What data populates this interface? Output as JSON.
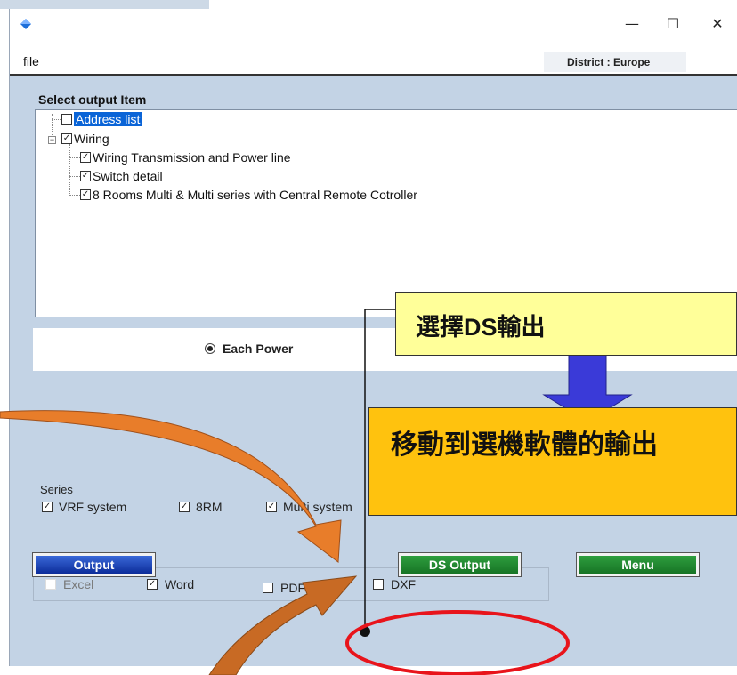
{
  "menu": {
    "file": "file"
  },
  "district": "District : Europe",
  "window_controls": {
    "minimize": "—",
    "maximize": "☐",
    "close": "✕"
  },
  "select_output": {
    "title": "Select output Item",
    "items": [
      {
        "label": "Address list",
        "checked": false,
        "selected": true
      },
      {
        "label": "Wiring",
        "checked": true
      },
      {
        "label": "Wiring Transmission and Power line",
        "checked": true
      },
      {
        "label": "Switch detail",
        "checked": true
      },
      {
        "label": "8 Rooms Multi & Multi series with Central Remote Cotroller",
        "checked": true
      }
    ]
  },
  "power": {
    "label": "Each Power",
    "selected": true
  },
  "series": {
    "title": "Series",
    "options": [
      {
        "label": "VRF system",
        "checked": true
      },
      {
        "label": "8RM",
        "checked": true
      },
      {
        "label": "Multi system",
        "checked": true
      }
    ]
  },
  "formats": [
    {
      "label": "Excel",
      "checked": false,
      "disabled": true
    },
    {
      "label": "Word",
      "checked": true
    },
    {
      "label": "PDF",
      "checked": false
    },
    {
      "label": "DXF",
      "checked": false
    }
  ],
  "buttons": {
    "output": "Output",
    "ds_output": "DS Output",
    "menu": "Menu"
  },
  "annotations": {
    "callout_select": "選擇DS輸出",
    "callout_move": "移動到選機軟體的輸出"
  },
  "colors": {
    "client_bg": "#c3d3e5",
    "selection": "#0a64d7",
    "callout_yellow": "#ffff99",
    "callout_orange": "#ffc20e",
    "highlight_ellipse": "#e8141b",
    "arrow_blue": "#3a3ad8",
    "arrow_orange": "#e87d2a"
  }
}
